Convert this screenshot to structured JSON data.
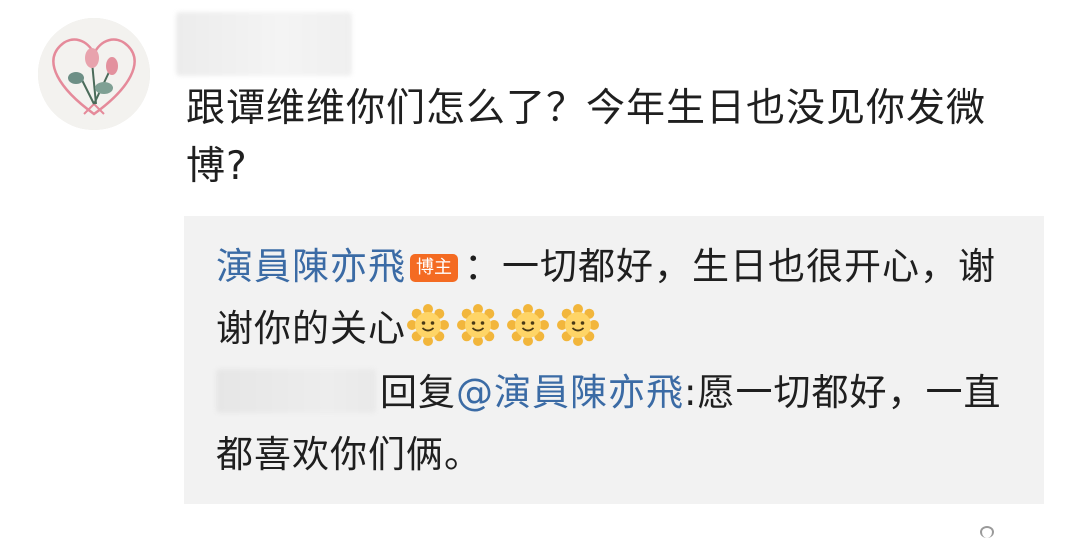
{
  "comment": {
    "text": "跟谭维维你们怎么了？今年生日也没见你发微博?"
  },
  "reply_thread": {
    "author_reply": {
      "author": "演員陳亦飛",
      "badge": "博主",
      "text": "：一切都好，生日也很开心，谢谢你的关心",
      "emoji_icon": "sun-smile-icon",
      "emoji_count": 4
    },
    "sub_reply": {
      "verb": "回复",
      "mention": "@演員陳亦飛",
      "text": ":愿一切都好，一直都喜欢你们俩。"
    }
  },
  "colors": {
    "link": "#3b6ba5",
    "badge_bg": "#f46b22",
    "reply_bg": "#f2f2f2"
  }
}
